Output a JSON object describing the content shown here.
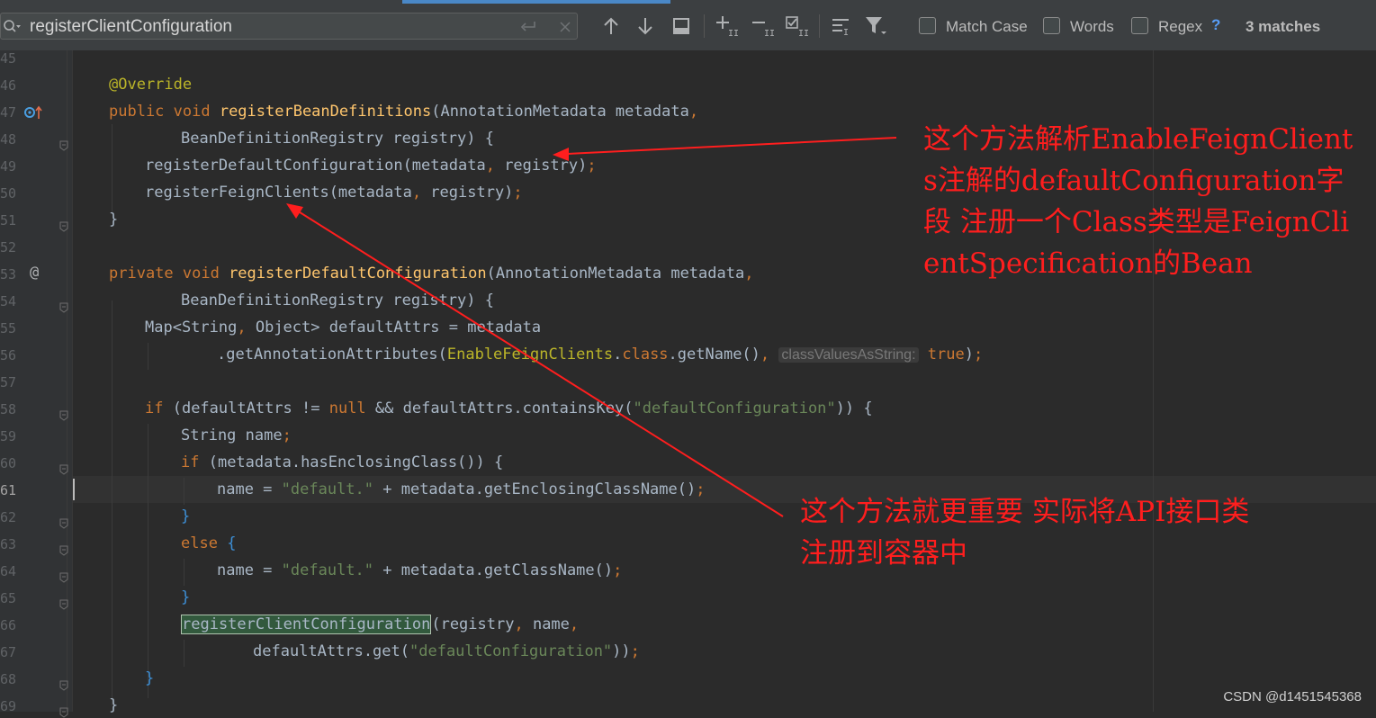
{
  "search": {
    "query": "registerClientConfiguration",
    "match_case_label": "Match Case",
    "words_label": "Words",
    "regex_label": "Regex",
    "regex_help": "?",
    "match_count": "3 matches",
    "match_case_checked": false,
    "words_checked": false,
    "regex_checked": false
  },
  "icons": {
    "search": "search-icon",
    "newline": "newline-icon",
    "clear": "clear-icon",
    "prev": "arrow-up-icon",
    "next": "arrow-down-icon",
    "select_all": "select-all-occurrences-icon",
    "add_selection": "add-selection-icon",
    "remove_selection": "remove-selection-icon",
    "select_all_occ": "toggle-selection-icon",
    "in_selection": "search-in-selection-icon",
    "filter": "filter-icon"
  },
  "colors": {
    "keyword": "#cc7832",
    "annotation": "#bbb529",
    "method": "#ffc66d",
    "string": "#6a8759",
    "plain": "#a9b7c6",
    "note": "#ff1e1e"
  },
  "editor": {
    "line_numbers": [
      "45",
      "46",
      "47",
      "48",
      "49",
      "50",
      "51",
      "52",
      "53",
      "54",
      "55",
      "56",
      "57",
      "58",
      "59",
      "60",
      "61",
      "62",
      "63",
      "64",
      "65",
      "66",
      "67",
      "68",
      "69"
    ],
    "active_line": "61",
    "code": {
      "l46": {
        "ann": "@Override"
      },
      "l47": {
        "kw1": "public void ",
        "fn": "registerBeanDefinitions",
        "p1": "(AnnotationMetadata metadata",
        "c": ","
      },
      "l48": {
        "p1": "BeanDefinitionRegistry registry) {"
      },
      "l49": {
        "p1": "registerDefaultConfiguration(metadata",
        "c": ",",
        "p2": " registry)",
        "s": ";"
      },
      "l50": {
        "p1": "registerFeignClients(metadata",
        "c": ",",
        "p2": " registry)",
        "s": ";"
      },
      "l51": {
        "p1": "}"
      },
      "l53": {
        "kw1": "private void ",
        "fn": "registerDefaultConfiguration",
        "p1": "(AnnotationMetadata metadata",
        "c": ","
      },
      "l54": {
        "p1": "BeanDefinitionRegistry registry) {"
      },
      "l55": {
        "p1": "Map<String",
        "c": ",",
        "p2": " Object> defaultAttrs = metadata"
      },
      "l56": {
        "p1": ".getAnnotationAttributes(",
        "p2": "EnableFeignClients",
        "d": ".",
        "kw": "class",
        "p3": ".getName()",
        "c": ",",
        "hint": "classValuesAsString:",
        "kw2": "true",
        "p4": ")",
        "s": ";"
      },
      "l58": {
        "kw1": "if ",
        "p1": "(defaultAttrs != ",
        "kw2": "null ",
        "p2": "&& defaultAttrs.containsKey(",
        "str": "\"defaultConfiguration\"",
        "p3": ")) {"
      },
      "l59": {
        "p1": "String name",
        "s": ";"
      },
      "l60": {
        "kw1": "if ",
        "p1": "(metadata.hasEnclosingClass()) {"
      },
      "l61": {
        "p1": "name = ",
        "str": "\"default.\"",
        "p2": " + metadata.getEnclosingClassName()",
        "s": ";"
      },
      "l62": {
        "p1": "}"
      },
      "l63": {
        "kw1": "else ",
        "p1": "{"
      },
      "l64": {
        "p1": "name = ",
        "str": "\"default.\"",
        "p2": " + metadata.getClassName()",
        "s": ";"
      },
      "l65": {
        "p1": "}"
      },
      "l66": {
        "hit": "registerClientConfiguration",
        "p1": "(registry",
        "c": ",",
        "p2": " name",
        "c2": ","
      },
      "l67": {
        "p1": "defaultAttrs.get(",
        "str": "\"defaultConfiguration\"",
        "p2": "))",
        "s": ";"
      },
      "l68": {
        "p1": "}"
      },
      "l69": {
        "p1": "}"
      }
    }
  },
  "notes": {
    "note1": "这个方法解析EnableFeignClients注解的defaultConfiguration字段 注册一个Class类型是FeignClientSpecification的Bean",
    "note2_line1": "这个方法就更重要 实际将API接口类",
    "note2_line2": "注册到容器中"
  },
  "watermark": "CSDN @d1451545368"
}
